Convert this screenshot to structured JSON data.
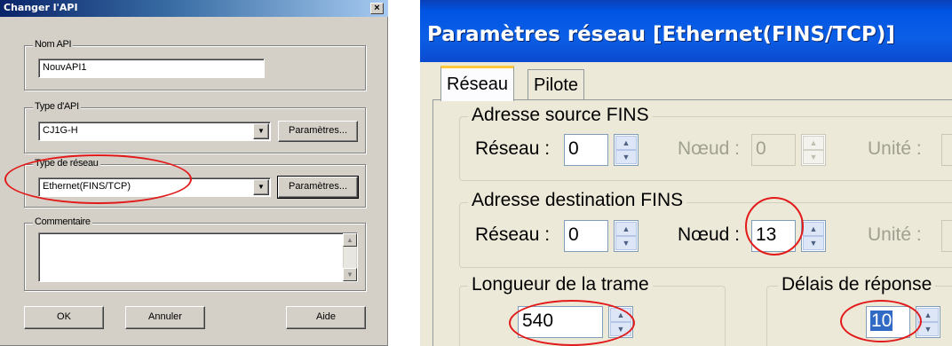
{
  "change_plc": {
    "title": "Changer l'API",
    "close_glyph": "×",
    "plc_name": {
      "label": "Nom API",
      "value": "NouvAPI1"
    },
    "plc_type": {
      "label": "Type d'API",
      "value": "CJ1G-H",
      "settings_button": "Paramètres..."
    },
    "network_type": {
      "label": "Type de réseau",
      "value": "Ethernet(FINS/TCP)",
      "settings_button": "Paramètres..."
    },
    "comment": {
      "label": "Commentaire",
      "value": ""
    },
    "buttons": {
      "ok": "OK",
      "cancel": "Annuler",
      "help": "Aide"
    },
    "icons": {
      "dropdown": "chevron-down-icon",
      "scroll_up": "up-arrow-icon",
      "scroll_down": "down-arrow-icon"
    }
  },
  "network_settings": {
    "title": "Paramètres réseau [Ethernet(FINS/TCP)]",
    "tabs": [
      "Réseau",
      "Pilote"
    ],
    "source_group": {
      "label": "Adresse source FINS",
      "network_label": "Réseau :",
      "network_value": "0",
      "node_label": "Nœud :",
      "node_value": "0",
      "unit_label": "Unité :"
    },
    "dest_group": {
      "label": "Adresse destination FINS",
      "network_label": "Réseau :",
      "network_value": "0",
      "node_label": "Nœud :",
      "node_value": "13",
      "unit_label": "Unité :"
    },
    "frame_group": {
      "label": "Longueur de la trame",
      "value": "540"
    },
    "response_group": {
      "label": "Délais de réponse",
      "value": "10"
    }
  },
  "colors": {
    "highlight_ring": "#e21a1a",
    "xp_title": "#0054e3",
    "classic_title": "#0a246a"
  }
}
